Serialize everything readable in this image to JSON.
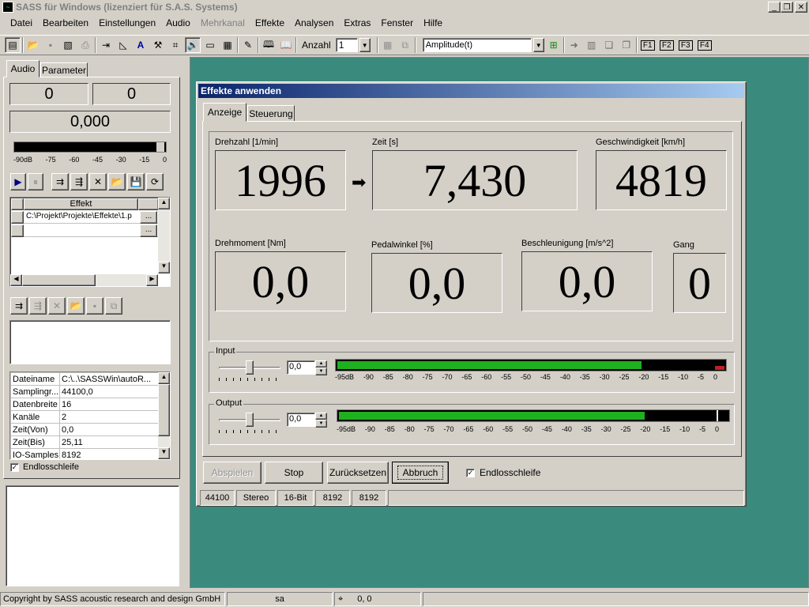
{
  "window": {
    "title": "SASS für Windows (lizenziert für S.A.S. Systems)"
  },
  "menu": [
    "Datei",
    "Bearbeiten",
    "Einstellungen",
    "Audio",
    "Mehrkanal",
    "Effekte",
    "Analysen",
    "Extras",
    "Fenster",
    "Hilfe"
  ],
  "toolbar": {
    "anzahl_label": "Anzahl",
    "anzahl_value": "1",
    "mode_value": "Amplitude(t)",
    "fkeys": [
      "F1",
      "F2",
      "F3",
      "F4"
    ]
  },
  "left": {
    "tabs": [
      "Audio",
      "Parameter"
    ],
    "val1": "0",
    "val2": "0",
    "val3": "0,000",
    "level_ticks": [
      "-90dB",
      "-75",
      "-60",
      "-45",
      "-30",
      "-15",
      "0"
    ],
    "grid_header": "Effekt",
    "grid_rows": [
      "C:\\Projekt\\Projekte\\Effekte\\1.p",
      ""
    ],
    "grid_btn": "...",
    "props": [
      [
        "Dateiname",
        "C:\\..\\SASSWin\\autoR..."
      ],
      [
        "Samplingr...",
        "44100,0"
      ],
      [
        "Datenbreite",
        "16"
      ],
      [
        "Kanäle",
        "2"
      ],
      [
        "Zeit(Von)",
        "0,0"
      ],
      [
        "Zeit(Bis)",
        "25,11"
      ],
      [
        "IO-Samples",
        "8192"
      ]
    ],
    "loop_label": "Endlosschleife"
  },
  "dialog": {
    "title": "Effekte anwenden",
    "tabs": [
      "Anzeige",
      "Steuerung"
    ],
    "readouts": [
      {
        "label": "Drehzahl [1/min]",
        "value": "1996"
      },
      {
        "label": "Zeit [s]",
        "value": "7,430"
      },
      {
        "label": "Geschwindigkeit [km/h]",
        "value": "4819"
      },
      {
        "label": "Drehmoment [Nm]",
        "value": "0,0"
      },
      {
        "label": "Pedalwinkel [%]",
        "value": "0,0"
      },
      {
        "label": "Beschleunigung [m/s^2]",
        "value": "0,0"
      },
      {
        "label": "Gang",
        "value": "0"
      }
    ],
    "input": {
      "label": "Input",
      "value": "0,0",
      "level": 0.78,
      "ticks": [
        "-95dB",
        "-90",
        "-85",
        "-80",
        "-75",
        "-70",
        "-65",
        "-60",
        "-55",
        "-50",
        "-45",
        "-40",
        "-35",
        "-30",
        "-25",
        "-20",
        "-15",
        "-10",
        "-5",
        "0"
      ]
    },
    "output": {
      "label": "Output",
      "value": "0,0",
      "level": 0.78,
      "ticks": [
        "-95dB",
        "-90",
        "-85",
        "-80",
        "-75",
        "-70",
        "-65",
        "-60",
        "-55",
        "-50",
        "-45",
        "-40",
        "-35",
        "-30",
        "-25",
        "-20",
        "-15",
        "-10",
        "-5",
        "0"
      ]
    },
    "buttons": {
      "play": "Abspielen",
      "stop": "Stop",
      "reset": "Zurücksetzen",
      "cancel": "Abbruch"
    },
    "loop_label": "Endlosschleife",
    "status": [
      "44100",
      "Stereo",
      "16-Bit",
      "8192",
      "8192"
    ]
  },
  "statusbar": {
    "copyright": "Copyright by SASS acoustic research and design GmbH",
    "mode": "sa",
    "coords": "0, 0"
  },
  "colors": {
    "desktop": "#3a8a7e",
    "titlebar": "#0a246a",
    "meter": "#1fb01f"
  }
}
